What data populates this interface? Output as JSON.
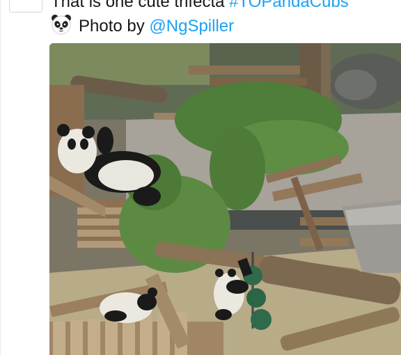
{
  "tweet": {
    "line1_text": "That is one cute trifecta ",
    "hashtag": "#TOPandaCubs",
    "line2_prefix": "Photo by ",
    "mention": "@NgSpiller"
  },
  "icons": {
    "emoji": "panda-face-icon"
  },
  "media": {
    "kind": "photo"
  },
  "colors": {
    "link": "#1da1f2",
    "text": "#14171a"
  }
}
